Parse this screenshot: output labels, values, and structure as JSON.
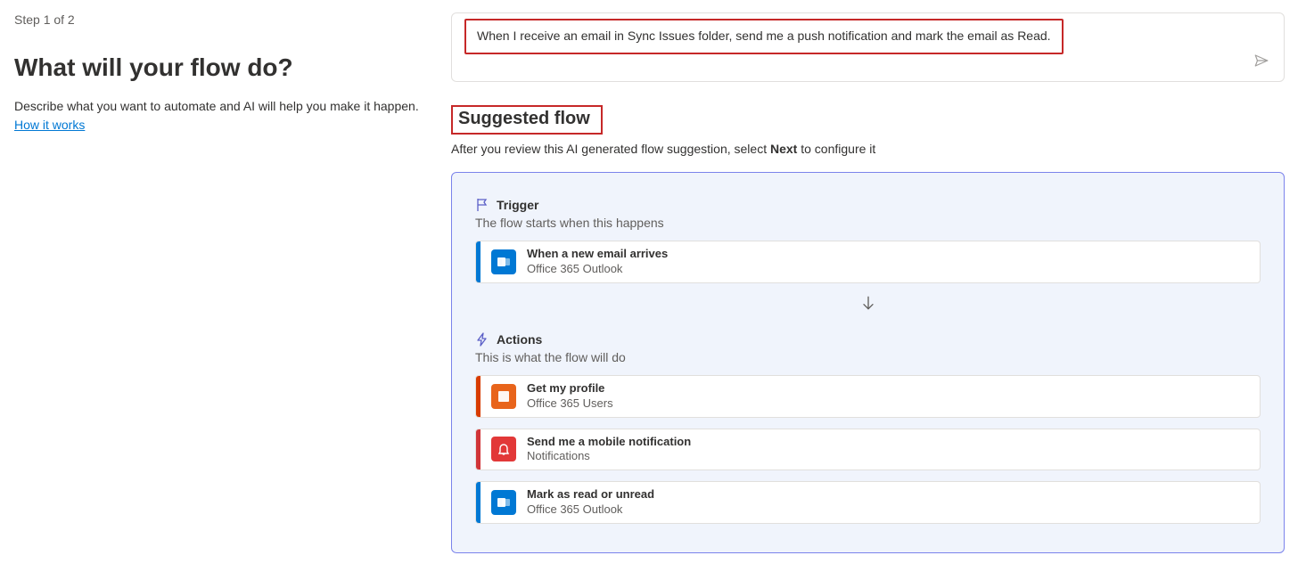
{
  "left": {
    "step": "Step 1 of 2",
    "title": "What will your flow do?",
    "desc": "Describe what you want to automate and AI will help you make it happen.",
    "how_link": "How it works"
  },
  "prompt": {
    "text": "When I receive an email in Sync Issues folder, send me a push notification and mark the email as Read."
  },
  "suggested": {
    "heading": "Suggested flow",
    "sub_before": "After you review this AI generated flow suggestion, select ",
    "sub_bold": "Next",
    "sub_after": " to configure it"
  },
  "trigger_section": {
    "label": "Trigger",
    "sub": "The flow starts when this happens"
  },
  "trigger": {
    "title": "When a new email arrives",
    "connector": "Office 365 Outlook"
  },
  "actions_section": {
    "label": "Actions",
    "sub": "This is what the flow will do"
  },
  "actions": [
    {
      "title": "Get my profile",
      "connector": "Office 365 Users"
    },
    {
      "title": "Send me a mobile notification",
      "connector": "Notifications"
    },
    {
      "title": "Mark as read or unread",
      "connector": "Office 365 Outlook"
    }
  ]
}
